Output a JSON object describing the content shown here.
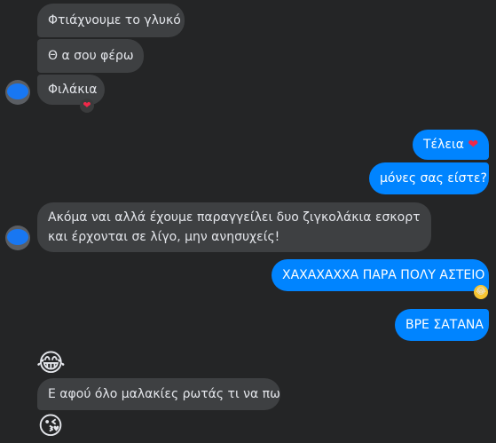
{
  "messages": {
    "m1": "Φτιάχνουμε το γλυκό",
    "m2": "Θ α σου φέρω",
    "m3": "Φιλάκια",
    "m4": "Τέλεια",
    "m5": "μόνες σας είστε?",
    "m6_line1": "Ακόμα ναι αλλά έχουμε παραγγείλει δυο ζιγκολάκια εσκορτ",
    "m6_line2": "και έρχονται σε λίγο, μην ανησυχείς!",
    "m7": "ΧΑΧΑΧΑΧΧΑ ΠΑΡΑ ΠΟΛΥ ΑΣΤΕΙΟ",
    "m8": "ΒΡΕ ΣΑΤΑΝΑ",
    "m9": "Ε αφού όλο μαλακίες ρωτάς τι να πω"
  },
  "emoji": {
    "heart": "❤",
    "laughing_tears": "😂",
    "blowing_kiss": "😘"
  },
  "colors": {
    "background": "#242526",
    "incoming_bubble": "#3e4042",
    "outgoing_bubble": "#0084ff",
    "heart": "#f02849"
  }
}
